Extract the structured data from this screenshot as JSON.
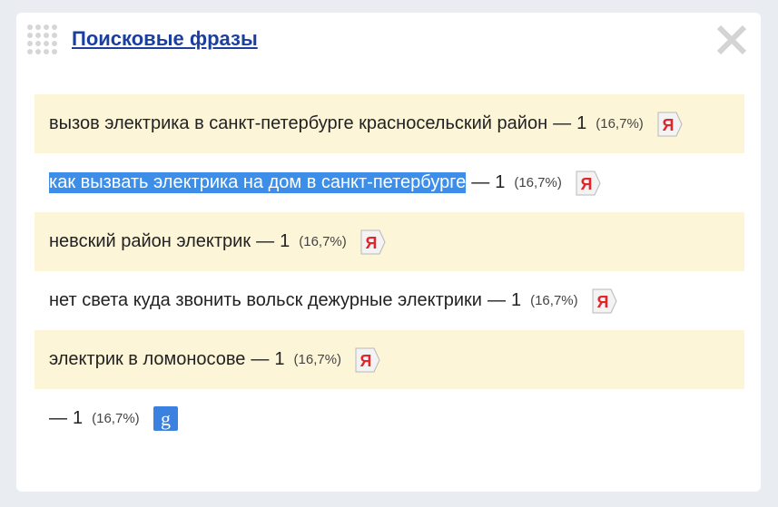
{
  "header": {
    "title": "Поисковые фразы",
    "close_icon": "close-icon",
    "grip_icon": "drag-handle-icon"
  },
  "separator": "—",
  "rows": [
    {
      "phrase": "вызов электрика в санкт-петербурге красносельский район",
      "count": "1",
      "percent": "(16,7%)",
      "engine": "yandex",
      "engine_letter": "Я"
    },
    {
      "phrase": "как вызвать электрика на дом в санкт-петербурге",
      "count": "1",
      "percent": "(16,7%)",
      "engine": "yandex",
      "engine_letter": "Я",
      "selected": true
    },
    {
      "phrase": "невский район электрик",
      "count": "1",
      "percent": "(16,7%)",
      "engine": "yandex",
      "engine_letter": "Я"
    },
    {
      "phrase": "нет света куда звонить вольск дежурные электрики",
      "count": "1",
      "percent": "(16,7%)",
      "engine": "yandex",
      "engine_letter": "Я"
    },
    {
      "phrase": "электрик в ломоносове",
      "count": "1",
      "percent": "(16,7%)",
      "engine": "yandex",
      "engine_letter": "Я"
    },
    {
      "phrase": "",
      "count": "1",
      "percent": "(16,7%)",
      "engine": "google",
      "engine_letter": "g"
    }
  ],
  "colors": {
    "title": "#1a3f9e",
    "alt_row": "#fcf5d8",
    "selection": "#3d8ee8",
    "yandex": "#e0262a",
    "google": "#3b82e0"
  }
}
